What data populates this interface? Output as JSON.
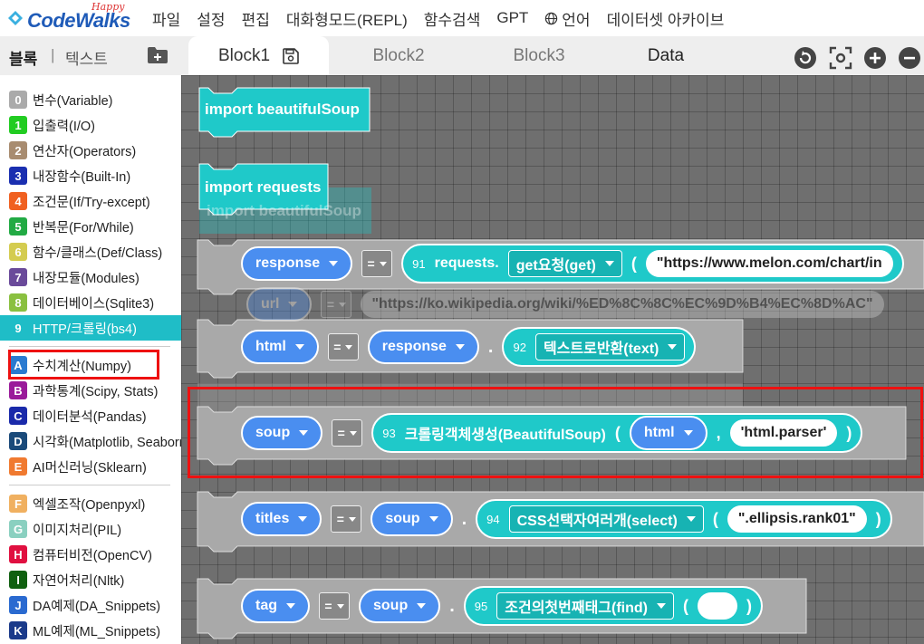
{
  "app": {
    "logo": "CodeWalks",
    "logo_sub": "Happy",
    "menu": [
      "파일",
      "설정",
      "편집",
      "대화형모드(REPL)",
      "함수검색",
      "GPT",
      "언어",
      "데이터셋 아카이브"
    ]
  },
  "sidebar": {
    "tab_active": "블록",
    "separator": "|",
    "tab_inactive": "텍스트",
    "categories": [
      {
        "num": "0",
        "label": "변수(Variable)",
        "color": "#aaaaaa"
      },
      {
        "num": "1",
        "label": "입출력(I/O)",
        "color": "#22cc22"
      },
      {
        "num": "2",
        "label": "연산자(Operators)",
        "color": "#a88c70"
      },
      {
        "num": "3",
        "label": "내장함수(Built-In)",
        "color": "#1a2fb0"
      },
      {
        "num": "4",
        "label": "조건문(If/Try-except)",
        "color": "#f06020"
      },
      {
        "num": "5",
        "label": "반복문(For/While)",
        "color": "#22aa44"
      },
      {
        "num": "6",
        "label": "함수/클래스(Def/Class)",
        "color": "#d4cc50"
      },
      {
        "num": "7",
        "label": "내장모듈(Modules)",
        "color": "#6a4a9a"
      },
      {
        "num": "8",
        "label": "데이터베이스(Sqlite3)",
        "color": "#8ac040"
      },
      {
        "num": "9",
        "label": "HTTP/크롤링(bs4)",
        "color": "#1fbdc7"
      },
      {
        "num": "A",
        "label": "수치계산(Numpy)",
        "color": "#2a7ad0"
      },
      {
        "num": "B",
        "label": "과학통계(Scipy, Stats)",
        "color": "#9a1a9a"
      },
      {
        "num": "C",
        "label": "데이터분석(Pandas)",
        "color": "#1a2aaa"
      },
      {
        "num": "D",
        "label": "시각화(Matplotlib, Seaborn)",
        "color": "#1a4a7a"
      },
      {
        "num": "E",
        "label": "AI머신러닝(Sklearn)",
        "color": "#f07a30"
      },
      {
        "num": "F",
        "label": "엑셀조작(Openpyxl)",
        "color": "#f0b060"
      },
      {
        "num": "G",
        "label": "이미지처리(PIL)",
        "color": "#8ad0c0"
      },
      {
        "num": "H",
        "label": "컴퓨터비전(OpenCV)",
        "color": "#e01040"
      },
      {
        "num": "I",
        "label": "자연어처리(Nltk)",
        "color": "#106010"
      },
      {
        "num": "J",
        "label": "DA예제(DA_Snippets)",
        "color": "#2a6ad0"
      },
      {
        "num": "K",
        "label": "ML예제(ML_Snippets)",
        "color": "#1a3a8a"
      }
    ]
  },
  "tabs": [
    "Block1",
    "Block2",
    "Block3",
    "Data"
  ],
  "workspace": {
    "import1": "import beautifulSoup",
    "import2": "import requests",
    "ghost_import": "import beautifulSoup",
    "eq": "=",
    "dot": ".",
    "open_paren": "(",
    "close_paren": ")",
    "comma": ",",
    "response_var": "response",
    "response_num": "91",
    "response_obj": "requests.",
    "response_method": "get요청(get)",
    "response_url": "\"https://www.melon.com/chart/in",
    "ghost_url_var": "url",
    "ghost_url_value": "\"https://ko.wikipedia.org/wiki/%ED%8C%8C%EC%9D%B4%EC%8D%AC\"",
    "html_var": "html",
    "html_obj": "response",
    "html_num": "92",
    "html_method": "텍스트로반환(text)",
    "soup_var": "soup",
    "soup_num": "93",
    "soup_func": "크롤링객체생성(BeautifulSoup)",
    "soup_arg": "html",
    "soup_parser": "'html.parser'",
    "ghost_soup_parser": "'html.parser'",
    "titles_var": "titles",
    "titles_obj": "soup",
    "titles_num": "94",
    "titles_method": "CSS선택자여러개(select)",
    "titles_arg": "\".ellipsis.rank01\"",
    "tag_var": "tag",
    "tag_obj": "soup",
    "tag_num": "95",
    "tag_method": "조건의첫번째태그(find)"
  }
}
